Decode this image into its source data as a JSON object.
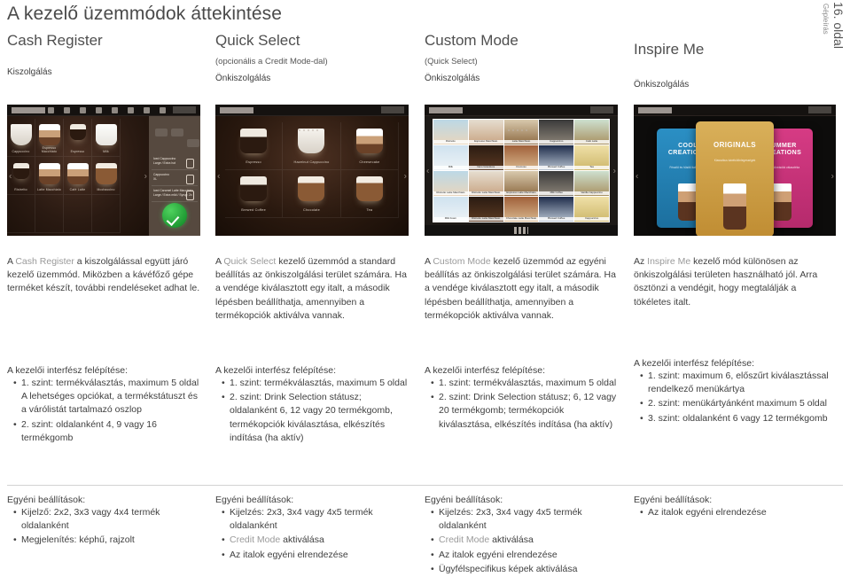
{
  "page": {
    "title": "A kezelő üzemmódok áttekintése",
    "side_tab_main": "16. oldal",
    "side_tab_sub": "Gépleírás"
  },
  "columns": [
    {
      "mode_name": "Cash Register",
      "mode_sub": "",
      "service": "Kiszolgálás",
      "desc_pre": "A ",
      "desc_hl": "Cash Register",
      "desc_post": " a kiszolgálással együtt járó kezelő üzemmód. Miközben a kávéfőző gépe terméket készít, további rendeléseket adhat le.",
      "struct_title": "A kezelői interfész felépítése:",
      "struct_items": [
        "1. szint: termékválasztás, maximum 5 oldal A lehetséges opciókat, a termékstátuszt és a várólistát tartalmazó oszlop",
        "2. szint: oldalanként 4, 9 vagy 16 termékgomb"
      ],
      "settings_title": "Egyéni beállítások:",
      "settings_items": [
        {
          "text": "Kijelző: 2x2, 3x3 vagy 4x4 termék oldalanként"
        },
        {
          "text": "Megjelenítés: képhű, rajzolt"
        }
      ],
      "screenshot": {
        "name": "cash-register-screen",
        "tiles": [
          "Cappuccino",
          "Espresso Macchiato",
          "Espresso",
          "Milk",
          "Ristretto",
          "Latte Macchiato",
          "Café Latte",
          "Mochaccino"
        ],
        "order_items": [
          {
            "line1": "Iced Cappuccino",
            "line2": "Large / Extra hot"
          },
          {
            "line1": "Cappuccino",
            "line2": "XL"
          },
          {
            "line1": "Iced Caramel Latte Macchiato",
            "line2": "Large / Extra mild / Syrup: 2x"
          }
        ],
        "confirm_icon": "check-icon"
      }
    },
    {
      "mode_name": "Quick Select",
      "mode_sub": "(opcionális a Credit Mode-dal)",
      "service": "Önkiszolgálás",
      "desc_pre": "A ",
      "desc_hl": "Quick Select",
      "desc_post": " kezelő üzemmód a standard beállítás az önkiszolgálási terület számára. Ha a vendége kiválasztott egy italt, a második lépésben beállíthatja, amennyiben a termékopciók aktiválva vannak.",
      "struct_title": "A kezelői interfész felépítése:",
      "struct_items": [
        "1. szint: termékválasztás, maximum 5 oldal",
        "2. szint: Drink Selection státusz; oldalanként 6, 12 vagy 20 termékgomb, termékopciók kiválasztása, elkészítés indítása (ha aktív)"
      ],
      "settings_title": "Egyéni beállítások:",
      "settings_items": [
        {
          "text": "Kijelzés: 2x3, 3x4 vagy 4x5 termék oldalanként"
        },
        {
          "hl": "Credit Mode",
          "text": " aktiválása"
        },
        {
          "text": "Az italok egyéni elrendezése"
        }
      ],
      "screenshot": {
        "name": "quick-select-screen",
        "tiles": [
          "Espresso",
          "Hazelnut Cappuccino",
          "Cheesecake",
          "Brewed Coffee",
          "Chocolate",
          "Tea"
        ]
      }
    },
    {
      "mode_name": "Custom Mode",
      "mode_sub": "(Quick Select)",
      "service": "Önkiszolgálás",
      "desc_pre": "A ",
      "desc_hl": "Custom Mode",
      "desc_post": " kezelő üzemmód az egyéni beállítás az önkiszolgálási terület számára. Ha a vendége kiválasztott egy italt, a második lépésben beállíthatja, amennyiben a termékopciók aktiválva vannak.",
      "struct_title": "A kezelői interfész felépítése:",
      "struct_items": [
        "1. szint: termékválasztás, maximum 5 oldal",
        "2. szint: Drink Selection státusz; 6, 12 vagy 20 termékgomb; termékopciók kiválasztása, elkészítés indítása (ha aktív)"
      ],
      "settings_title": "Egyéni beállítások:",
      "settings_items": [
        {
          "text": "Kijelzés: 2x3, 3x4 vagy 4x5 termék oldalanként"
        },
        {
          "hl": "Credit Mode",
          "text": " aktiválása"
        },
        {
          "text": "Az italok egyéni elrendezése"
        },
        {
          "text": "Ügyfélspecifikus képek aktiválása"
        }
      ],
      "screenshot": {
        "name": "custom-mode-screen",
        "tiles": [
          "Ristretto",
          "Espresso Macchiato",
          "Latte Macchiato",
          "Cappuccino",
          "Café Latte",
          "Milk",
          "Nero Granduca",
          "Cremoso",
          "Brewed Coffee",
          "Tea",
          "Ristretto Latte Macchiato",
          "Ristretto Latte Macchiato",
          "Espresso Latte Macchiato",
          "Milk Coffee",
          "Vanilla Cappuccino",
          "Milk Foam",
          "Ristretto Latte Macchiato",
          "Chocolate Latte Macchiato",
          "Brewed Coffee",
          "Cappuccino"
        ]
      }
    },
    {
      "mode_name": "Inspire Me",
      "mode_sub": "",
      "service": "Önkiszolgálás",
      "desc_pre": "Az ",
      "desc_hl": "Inspire Me",
      "desc_post": " kezelő mód különösen az önkiszolgálási területen használható jól. Arra ösztönzi a vendégit, hogy megtalálják a tökéletes italt.",
      "struct_title": "A kezelői interfész felépítése:",
      "struct_items": [
        "1. szint: maximum 6, előszűrt kiválasztással rendelkező menükártya",
        "2. szint: menükártyánként maximum 5 oldal",
        "3. szint: oldalanként 6 vagy 12 termékgomb"
      ],
      "settings_title": "Egyéni beállítások:",
      "settings_items": [
        {
          "text": "Az italok egyéni elrendezése"
        }
      ],
      "screenshot": {
        "name": "inspire-me-screen",
        "cards": [
          {
            "title": "COOL CREATIONS",
            "subtitle": "Frissítő és hűsítő italkreációk"
          },
          {
            "title": "ORIGINALS",
            "subtitle": "Klasszikus kávékülönlegességek"
          },
          {
            "title": "SUMMER CREATIONS",
            "subtitle": "Nyári italkreációk választéka"
          }
        ]
      }
    }
  ]
}
